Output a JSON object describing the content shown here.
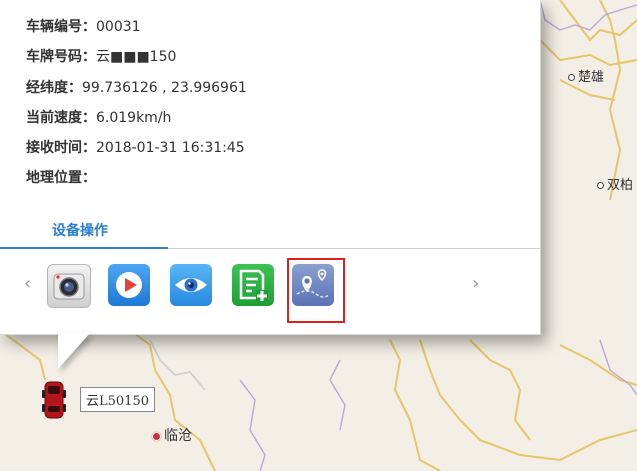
{
  "vehicle_info": {
    "vehicle_no_label": "车辆编号：",
    "vehicle_no": "00031",
    "plate_label": "车牌号码：",
    "plate": "云■■■150",
    "coords_label": "经纬度：",
    "coords": "99.736126 , 23.996961",
    "speed_label": "当前速度：",
    "speed": "6.019km/h",
    "time_label": "接收时间：",
    "time": "2018-01-31 16:31:45",
    "location_label": "地理位置：",
    "location": ""
  },
  "tabs": {
    "device_ops": "设备操作"
  },
  "nav": {
    "prev": "‹",
    "next": "›"
  },
  "tools": [
    {
      "name": "camera",
      "icon": "camera-icon"
    },
    {
      "name": "playback",
      "icon": "play-icon"
    },
    {
      "name": "monitor",
      "icon": "eye-icon"
    },
    {
      "name": "text-message",
      "icon": "document-plus-icon"
    },
    {
      "name": "track",
      "icon": "map-pin-icon"
    }
  ],
  "map": {
    "places": {
      "chuxiong": "楚雄",
      "shuangbai": "双柏",
      "lincang": "临沧"
    },
    "vehicle_plate_label": "云L50150"
  },
  "colors": {
    "accent": "#2a7fd4",
    "highlight": "#e02020",
    "road": "#e6c66a",
    "border_line": "#b9a8d6"
  }
}
